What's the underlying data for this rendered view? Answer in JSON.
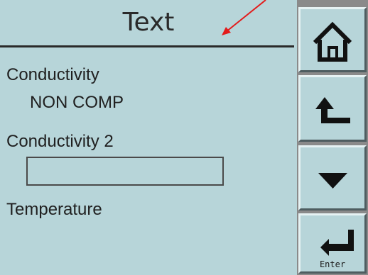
{
  "screen": {
    "title": "Text"
  },
  "fields": [
    {
      "label": "Conductivity",
      "value": "NON COMP"
    },
    {
      "label": "Conductivity 2",
      "value": ""
    },
    {
      "label": "Temperature"
    }
  ],
  "buttons": {
    "home_icon": "home-icon",
    "back_icon": "return-arrow-icon",
    "down_icon": "down-triangle-icon",
    "enter_icon": "enter-arrow-icon",
    "enter_label": "Enter"
  },
  "colors": {
    "background": "#b7d5d9",
    "text": "#202020",
    "annotation_arrow": "#e31b1b"
  }
}
